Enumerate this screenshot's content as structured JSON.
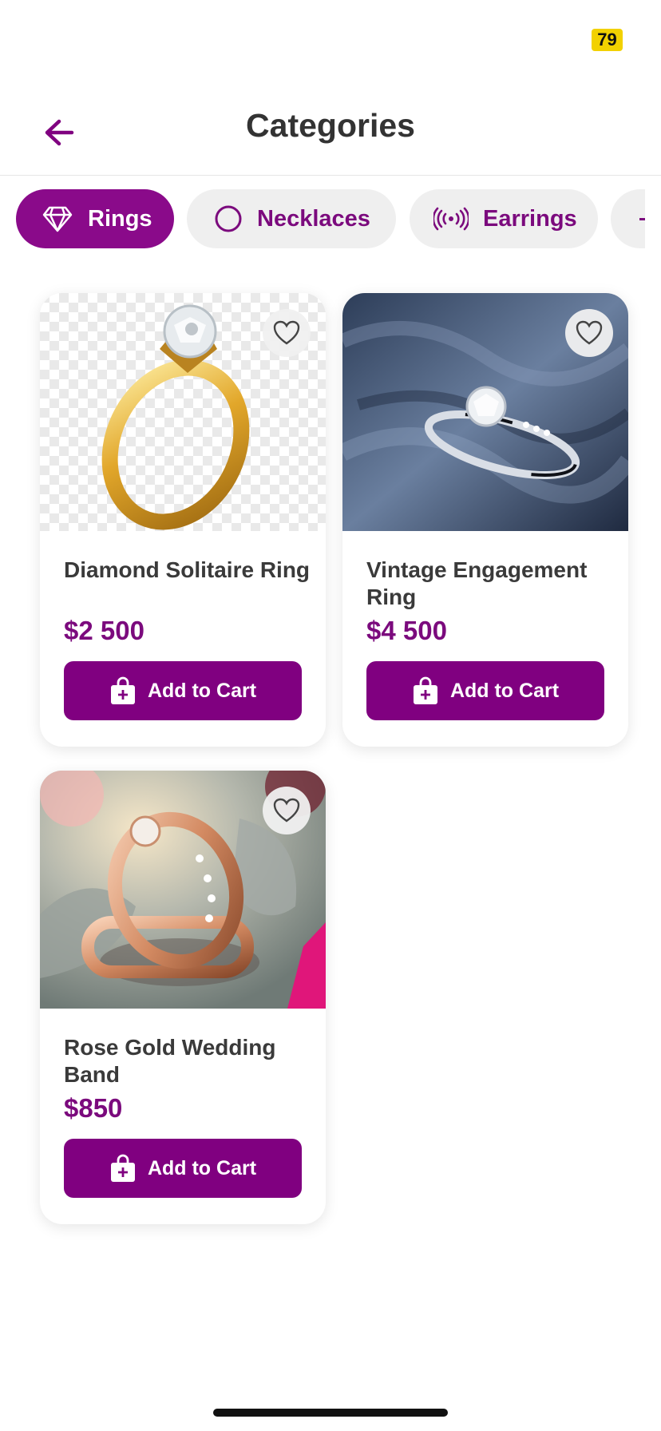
{
  "status": {
    "battery": "79"
  },
  "header": {
    "title": "Categories",
    "back_icon": "arrow-left-icon"
  },
  "colors": {
    "accent": "#800080",
    "chip_inactive_bg": "#efefef",
    "badge": "#f2d100"
  },
  "chips": [
    {
      "label": "Rings",
      "icon": "diamond-icon",
      "active": true
    },
    {
      "label": "Necklaces",
      "icon": "circle-icon",
      "active": false
    },
    {
      "label": "Earrings",
      "icon": "signal-icon",
      "active": false
    }
  ],
  "products": [
    {
      "name": "Diamond Solitaire Ring",
      "price": "$2 500",
      "button": "Add to Cart",
      "favorite": false
    },
    {
      "name": "Vintage Engagement Ring",
      "price": "$4 500",
      "button": "Add to Cart",
      "favorite": false
    },
    {
      "name": "Rose Gold Wedding Band",
      "price": "$850",
      "button": "Add to Cart",
      "favorite": false
    }
  ]
}
